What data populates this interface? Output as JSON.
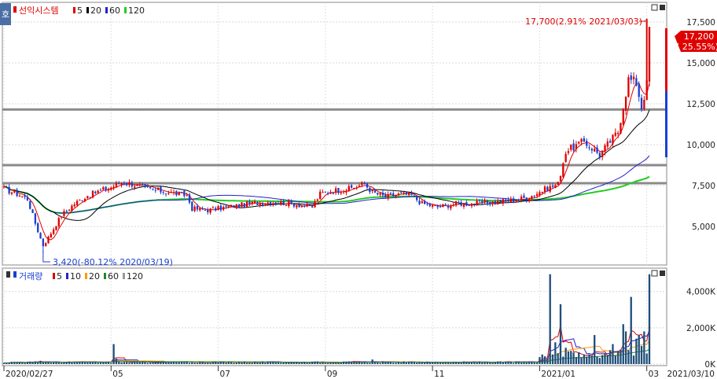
{
  "chart_data": [
    {
      "type": "candlestick",
      "title": "선익시스템",
      "legend": [
        {
          "label": "5",
          "color": "#e00000"
        },
        {
          "label": "20",
          "color": "#000000"
        },
        {
          "label": "60",
          "color": "#2222cc"
        },
        {
          "label": "120",
          "color": "#22cc22"
        }
      ],
      "ylim": [
        2700,
        18600
      ],
      "yticks": [
        "5,000",
        "7,500",
        "10,000",
        "12,500",
        "15,000",
        "17,500"
      ],
      "last_price": "17,200",
      "last_change": "( 25.55%)",
      "high_annotation": "17,700(2.91% 2021/03/03)",
      "low_annotation": "3,420(-80.12% 2020/03/19)",
      "high_point": {
        "i": 246,
        "v": 17700
      },
      "low_point": {
        "i": 15,
        "v": 3420
      },
      "levels": [
        12150,
        8750,
        7650
      ],
      "keypoints": [
        [
          0,
          7300
        ],
        [
          5,
          7000
        ],
        [
          9,
          6700
        ],
        [
          12,
          5200
        ],
        [
          15,
          3800
        ],
        [
          18,
          4600
        ],
        [
          22,
          5700
        ],
        [
          27,
          6400
        ],
        [
          32,
          6900
        ],
        [
          37,
          7200
        ],
        [
          41,
          7400
        ],
        [
          45,
          7700
        ],
        [
          49,
          7600
        ],
        [
          55,
          7300
        ],
        [
          63,
          7100
        ],
        [
          70,
          6900
        ],
        [
          72,
          6100
        ],
        [
          78,
          6000
        ],
        [
          86,
          6200
        ],
        [
          94,
          6400
        ],
        [
          102,
          6500
        ],
        [
          110,
          6400
        ],
        [
          118,
          6200
        ],
        [
          121,
          7000
        ],
        [
          126,
          7200
        ],
        [
          132,
          7300
        ],
        [
          138,
          7600
        ],
        [
          141,
          7100
        ],
        [
          146,
          6800
        ],
        [
          152,
          7000
        ],
        [
          156,
          6900
        ],
        [
          160,
          6400
        ],
        [
          166,
          6200
        ],
        [
          173,
          6400
        ],
        [
          180,
          6400
        ],
        [
          187,
          6500
        ],
        [
          194,
          6600
        ],
        [
          201,
          6800
        ],
        [
          206,
          7200
        ],
        [
          212,
          7600
        ],
        [
          215,
          9600
        ],
        [
          222,
          10200
        ],
        [
          228,
          9400
        ],
        [
          235,
          10800
        ],
        [
          239,
          14000
        ],
        [
          242,
          13800
        ],
        [
          244,
          12300
        ],
        [
          246,
          13700
        ],
        [
          247,
          17200
        ]
      ],
      "x_count": 248
    },
    {
      "type": "bar",
      "title": "거래량",
      "legend": [
        {
          "label": "5",
          "color": "#e00000"
        },
        {
          "label": "10",
          "color": "#2222cc"
        },
        {
          "label": "20",
          "color": "#ff9900"
        },
        {
          "label": "60",
          "color": "#228822"
        },
        {
          "label": "120",
          "color": "#999999"
        }
      ],
      "ylim": [
        0,
        5200
      ],
      "yticks": [
        "0K",
        "2,000K",
        "4,000K"
      ],
      "xticks": [
        {
          "i": 0,
          "label": "2020/02/27"
        },
        {
          "i": 41,
          "label": "05"
        },
        {
          "i": 82,
          "label": "07"
        },
        {
          "i": 123,
          "label": "09"
        },
        {
          "i": 164,
          "label": "11"
        },
        {
          "i": 205,
          "label": "2021/01"
        },
        {
          "i": 246,
          "label": "03"
        }
      ],
      "end_date": "2021/03/10",
      "spikes": [
        [
          14,
          180
        ],
        [
          17,
          130
        ],
        [
          42,
          1100
        ],
        [
          43,
          300
        ],
        [
          120,
          150
        ],
        [
          141,
          250
        ],
        [
          205,
          380
        ],
        [
          209,
          4950
        ],
        [
          211,
          1200
        ],
        [
          212,
          600
        ],
        [
          213,
          3300
        ],
        [
          215,
          900
        ],
        [
          216,
          700
        ],
        [
          220,
          650
        ],
        [
          223,
          400
        ],
        [
          225,
          450
        ],
        [
          226,
          1600
        ],
        [
          230,
          600
        ],
        [
          233,
          1100
        ],
        [
          235,
          700
        ],
        [
          236,
          800
        ],
        [
          237,
          2200
        ],
        [
          238,
          1800
        ],
        [
          240,
          3700
        ],
        [
          242,
          1400
        ],
        [
          243,
          1600
        ],
        [
          244,
          1000
        ],
        [
          245,
          1800
        ],
        [
          247,
          4950
        ]
      ]
    }
  ]
}
